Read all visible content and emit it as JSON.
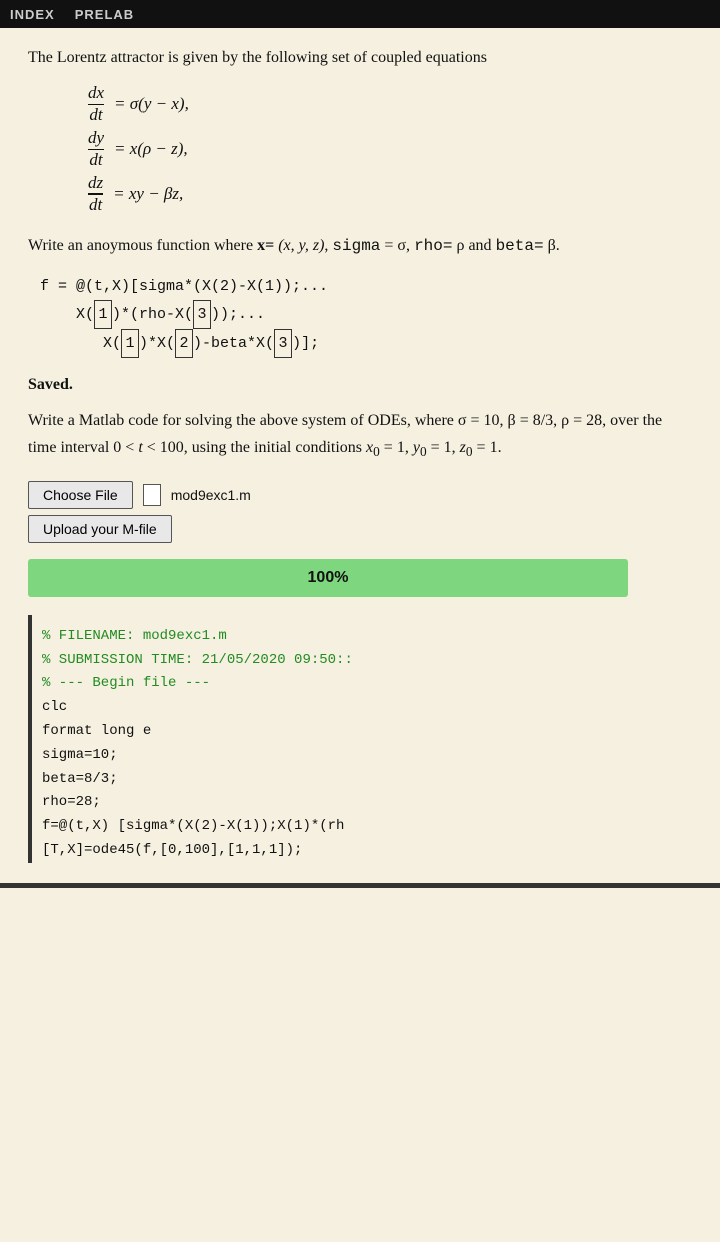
{
  "topbar": {
    "items": [
      "INDEX",
      "PRELAB"
    ]
  },
  "intro": {
    "text": "The Lorentz attractor is given by the following set of coupled equations"
  },
  "equations": [
    {
      "num": "dx",
      "den": "dt",
      "rhs": "= σ(y − x),"
    },
    {
      "num": "dy",
      "den": "dt",
      "rhs": "= x(ρ − z),"
    },
    {
      "num": "dz",
      "den": "dt",
      "rhs": "= xy − βz,"
    }
  ],
  "write_anon": {
    "text1": "Write an anoymous function where x= ",
    "text2": "(x, y, z),",
    "text3": " sigma = σ, rho= ρ and beta= β."
  },
  "code_anon": {
    "line1": "f = @(t,X)[sigma*(X(2)-X(1));...",
    "line2_pre": "X(",
    "line2_b1": "1",
    "line2_mid": ")*(rho-X(",
    "line2_b2": "3",
    "line2_end": "));...",
    "line3_pre": "X(",
    "line3_b1": "1",
    "line3_mid1": ")*X(",
    "line3_b2": "2",
    "line3_mid2": ")-beta*X(",
    "line3_b3": "3",
    "line3_end": ")];"
  },
  "saved": {
    "label": "Saved."
  },
  "ode_problem": {
    "line1": "Write a Matlab code for solving the above system of",
    "line2": "ODEs, where σ = 10, β = 8/3, ρ = 28, over the time",
    "line3": "interval 0 < t < 100, using the initial conditions",
    "line4": "x₀ = 1, y₀ = 1, z₀ = 1."
  },
  "file_upload": {
    "choose_label": "Choose File",
    "file_name": "mod9exc1.m",
    "upload_label": "Upload your M-file",
    "progress": "100%"
  },
  "submission_code": {
    "line1": "% FILENAME: mod9exc1.m",
    "line2": "% SUBMISSION TIME: 21/05/2020 09:50::",
    "line3": "% --- Begin file ---",
    "line4": "clc",
    "line5": "format long e",
    "line6": "sigma=10;",
    "line7": "beta=8/3;",
    "line8": "rho=28;",
    "line9": "f=@(t,X) [sigma*(X(2)-X(1));X(1)*(rh",
    "line10": "[T,X]=ode45(f,[0,100],[1,1,1]);"
  }
}
